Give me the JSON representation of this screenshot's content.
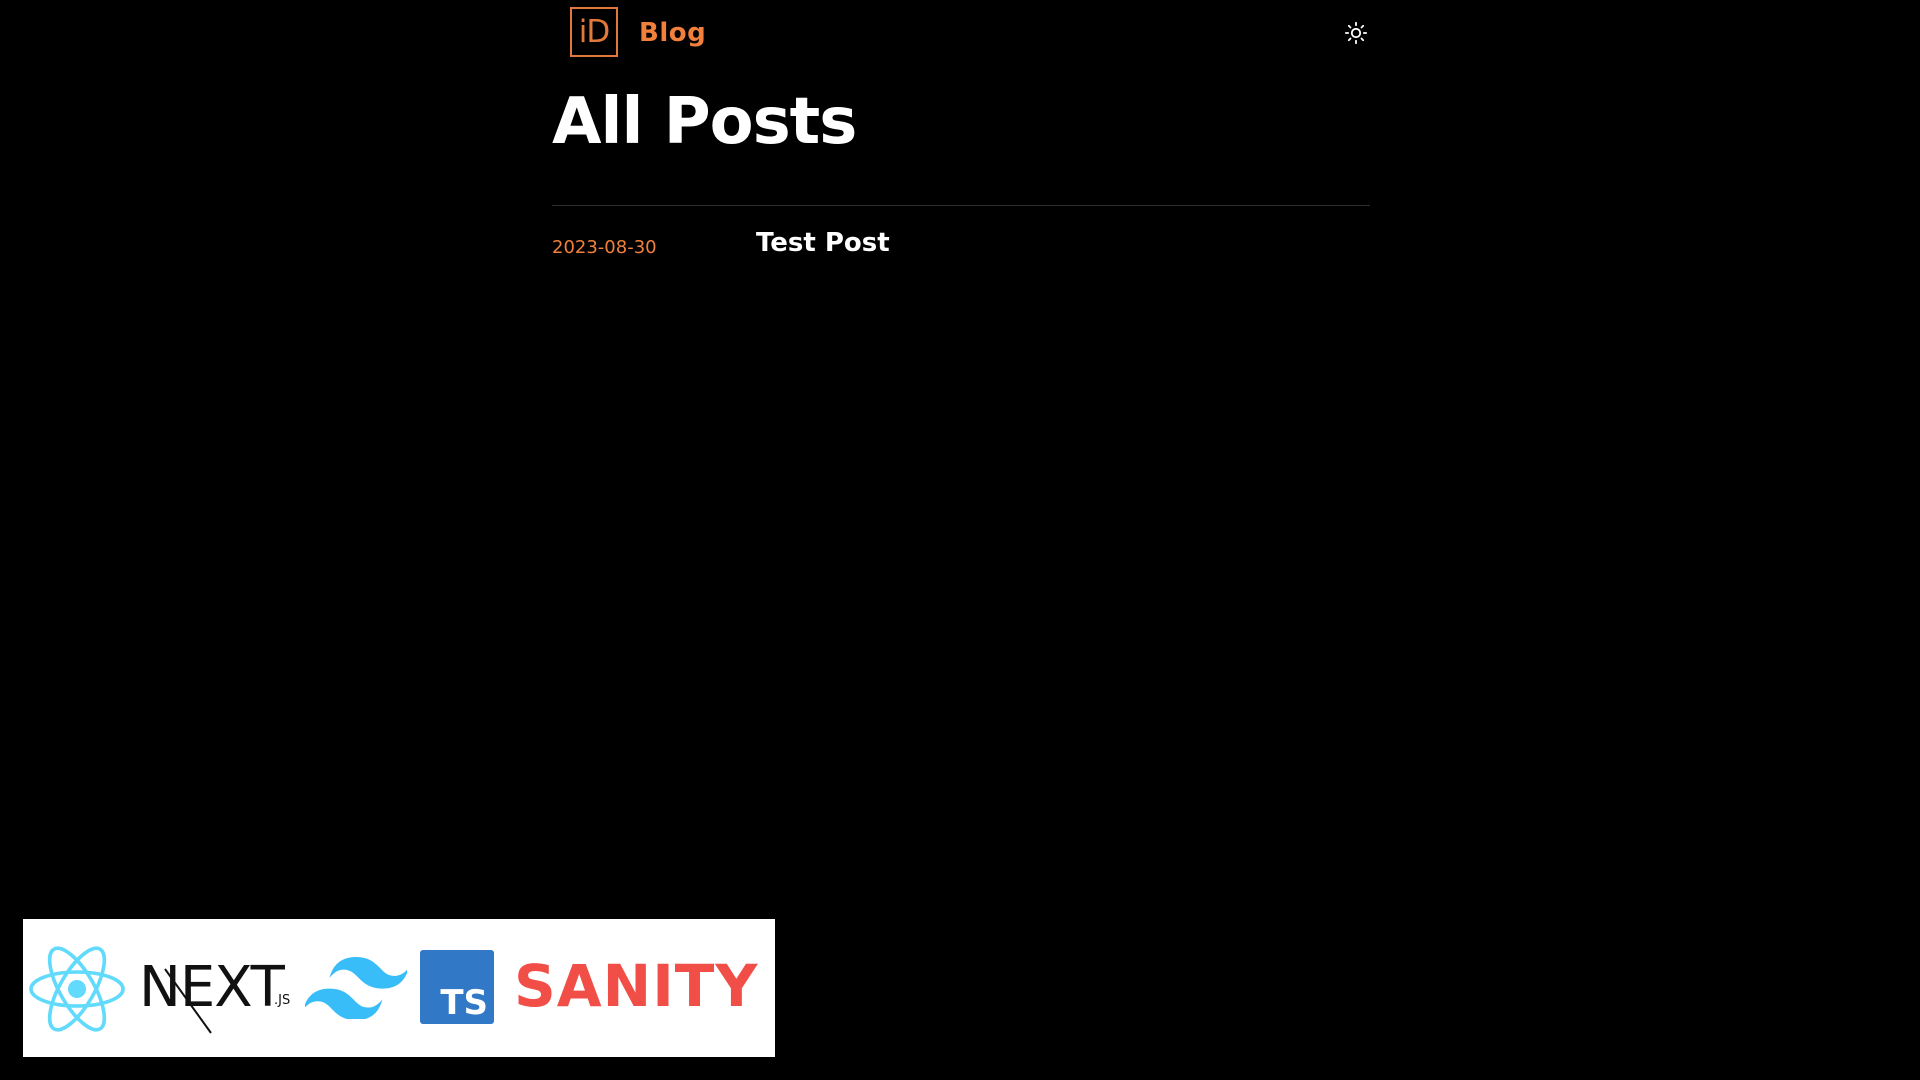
{
  "header": {
    "logo_text": "iD",
    "blog_link": "Blog",
    "theme_toggle_icon": "sun-icon"
  },
  "main": {
    "title": "All Posts",
    "posts": [
      {
        "date": "2023-08-30",
        "title": "Test Post"
      }
    ]
  },
  "tech_banner": {
    "logos": [
      "react-logo",
      "nextjs-logo",
      "tailwind-logo",
      "typescript-logo",
      "sanity-logo"
    ],
    "next_text": "NEXT",
    "next_suffix": ".JS",
    "ts_text": "TS",
    "sanity_text": "SANITY"
  },
  "colors": {
    "background": "#000000",
    "accent": "#f0803c",
    "text": "#ffffff",
    "react": "#61dafb",
    "tailwind": "#38bdf8",
    "typescript": "#3178c6",
    "sanity": "#f04e46"
  }
}
